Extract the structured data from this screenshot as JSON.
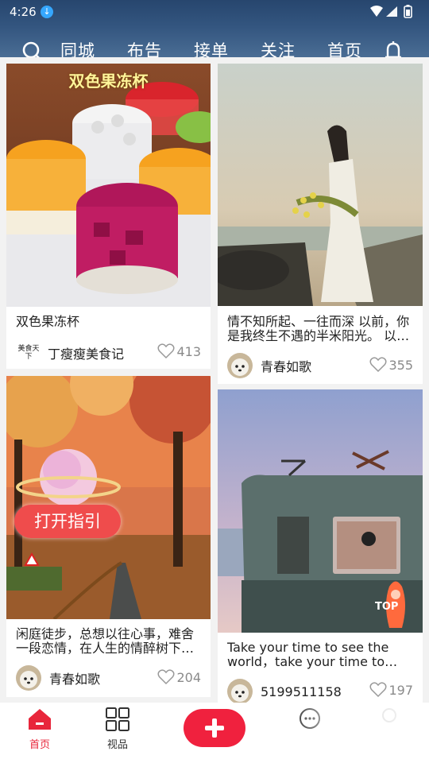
{
  "status_bar": {
    "time": "4:26"
  },
  "nav": {
    "tabs": [
      {
        "label": "同城"
      },
      {
        "label": "布告"
      },
      {
        "label": "接单"
      },
      {
        "label": "关注"
      },
      {
        "label": "首页",
        "active": true
      }
    ]
  },
  "feed": {
    "cards": [
      {
        "overlay_title": "双色果冻杯",
        "title": "双色果冻杯",
        "author": "丁瘦瘦美食记",
        "author_logo": "美食天下",
        "likes": "413"
      },
      {
        "title": "情不知所起、一往而深 以前，你是我终生不遇的半米阳光。 以…",
        "author": "青春如歌",
        "likes": "355"
      },
      {
        "overlay_button": "打开指引",
        "title": "闲庭徒步，总想以往心事，难舍一段恋情，在人生的情醉树下…",
        "author": "青春如歌",
        "likes": "204"
      },
      {
        "overlay_badge": "TOP",
        "title": "Take your time to see the world，take your time to…",
        "author": "5199511158",
        "likes": "197"
      }
    ]
  },
  "bottom_nav": {
    "items": [
      {
        "label": "首页",
        "active": true
      },
      {
        "label": "视品"
      }
    ]
  },
  "colors": {
    "accent": "#e8263b",
    "plus_button": "#f0213e",
    "header": "#33557f"
  }
}
